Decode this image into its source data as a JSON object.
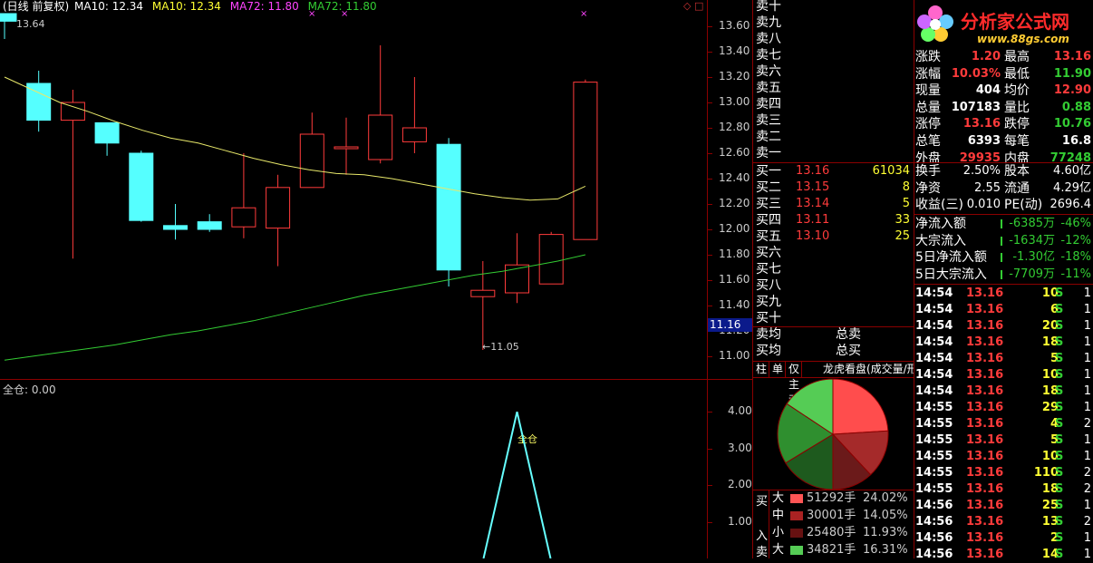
{
  "chart_header": {
    "period": "(日线 前复权)",
    "ma10_a": "MA10: 12.34",
    "ma10_b": "MA10: 12.34",
    "ma72_a": "MA72: 11.80",
    "ma72_b": "MA72: 11.80",
    "high_marker": "13.64",
    "low_marker": "11.05",
    "current_price_box": "11.16"
  },
  "price_axis": [
    "13.60",
    "13.40",
    "13.20",
    "13.00",
    "12.80",
    "12.60",
    "12.40",
    "12.20",
    "12.00",
    "11.80",
    "11.60",
    "11.40",
    "11.20",
    "11.00"
  ],
  "indicator": {
    "title": "全仓: 0.00",
    "peak_label": "全仓",
    "axis": [
      "4.00",
      "3.00",
      "2.00",
      "1.00"
    ]
  },
  "chart_data": {
    "type": "candlestick",
    "ylim": [
      10.95,
      13.7
    ],
    "candles": [
      {
        "o": 13.7,
        "h": 13.64,
        "l": 13.5,
        "c": 13.64,
        "up": false
      },
      {
        "o": 13.15,
        "h": 13.25,
        "l": 12.77,
        "c": 12.86,
        "up": false
      },
      {
        "o": 12.86,
        "h": 13.1,
        "l": 11.77,
        "c": 13.0,
        "up": true
      },
      {
        "o": 12.84,
        "h": 12.84,
        "l": 12.58,
        "c": 12.68,
        "up": false
      },
      {
        "o": 12.6,
        "h": 12.62,
        "l": 12.06,
        "c": 12.07,
        "up": false
      },
      {
        "o": 12.03,
        "h": 12.2,
        "l": 11.92,
        "c": 12.0,
        "up": false
      },
      {
        "o": 12.0,
        "h": 12.12,
        "l": 11.98,
        "c": 12.06,
        "up": false
      },
      {
        "o": 12.02,
        "h": 12.6,
        "l": 11.93,
        "c": 12.17,
        "up": true
      },
      {
        "o": 12.01,
        "h": 12.43,
        "l": 11.71,
        "c": 12.33,
        "up": true
      },
      {
        "o": 12.33,
        "h": 12.92,
        "l": 12.33,
        "c": 12.75,
        "up": true
      },
      {
        "o": 12.65,
        "h": 12.88,
        "l": 12.43,
        "c": 12.65,
        "up": true
      },
      {
        "o": 12.55,
        "h": 13.45,
        "l": 12.52,
        "c": 12.9,
        "up": true
      },
      {
        "o": 12.69,
        "h": 13.2,
        "l": 12.6,
        "c": 12.8,
        "up": true
      },
      {
        "o": 12.67,
        "h": 12.72,
        "l": 11.55,
        "c": 11.68,
        "up": false
      },
      {
        "o": 11.47,
        "h": 11.75,
        "l": 11.05,
        "c": 11.52,
        "up": true
      },
      {
        "o": 11.5,
        "h": 11.97,
        "l": 11.42,
        "c": 11.72,
        "up": true
      },
      {
        "o": 11.57,
        "h": 11.98,
        "l": 11.57,
        "c": 11.96,
        "up": true
      },
      {
        "o": 11.92,
        "h": 13.18,
        "l": 11.92,
        "c": 13.16,
        "up": true
      }
    ],
    "ma10": [
      13.2,
      13.1,
      13.0,
      12.93,
      12.85,
      12.78,
      12.72,
      12.68,
      12.62,
      12.56,
      12.51,
      12.47,
      12.44,
      12.43,
      12.4,
      12.36,
      12.32,
      12.28,
      12.25,
      12.23,
      12.24,
      12.34
    ],
    "ma72": [
      10.97,
      11.0,
      11.03,
      11.06,
      11.09,
      11.13,
      11.17,
      11.2,
      11.24,
      11.28,
      11.33,
      11.38,
      11.43,
      11.48,
      11.52,
      11.56,
      11.6,
      11.64,
      11.67,
      11.71,
      11.75,
      11.8
    ],
    "indicator_values": [
      0,
      0,
      0,
      0,
      0,
      0,
      0,
      0,
      0,
      0,
      0,
      0,
      0,
      0,
      0,
      4,
      0,
      0
    ],
    "indicator_ylim": [
      0,
      4.4
    ]
  },
  "sell_levels": [
    "卖十",
    "卖九",
    "卖八",
    "卖七",
    "卖六",
    "卖五",
    "卖四",
    "卖三",
    "卖二",
    "卖一"
  ],
  "buy_levels": [
    {
      "label": "买一",
      "price": "13.16",
      "vol": "61034"
    },
    {
      "label": "买二",
      "price": "13.15",
      "vol": "8"
    },
    {
      "label": "买三",
      "price": "13.14",
      "vol": "5"
    },
    {
      "label": "买四",
      "price": "13.11",
      "vol": "33"
    },
    {
      "label": "买五",
      "price": "13.10",
      "vol": "25"
    },
    {
      "label": "买六",
      "price": "",
      "vol": ""
    },
    {
      "label": "买七",
      "price": "",
      "vol": ""
    },
    {
      "label": "买八",
      "price": "",
      "vol": ""
    },
    {
      "label": "买九",
      "price": "",
      "vol": ""
    },
    {
      "label": "买十",
      "price": "",
      "vol": ""
    }
  ],
  "avg_rows": [
    {
      "label": "卖均",
      "total": "总卖"
    },
    {
      "label": "买均",
      "total": "总买"
    }
  ],
  "tabs": [
    "柱",
    "单",
    "仅主动",
    "龙虎看盘(成交量/形"
  ],
  "logo": {
    "text": "分析家公式网",
    "url": "www.88gs.com"
  },
  "quote_rows": [
    {
      "l1": "涨跌",
      "v1": "1.20",
      "l2": "最高",
      "v2": "13.16"
    },
    {
      "l1": "涨幅",
      "v1": "10.03%",
      "l2": "最低",
      "v2": "11.90"
    },
    {
      "l1": "现量",
      "v1": "404",
      "l2": "均价",
      "v2": "12.90"
    },
    {
      "l1": "总量",
      "v1": "107183",
      "l2": "量比",
      "v2": "0.88"
    },
    {
      "l1": "涨停",
      "v1": "13.16",
      "l2": "跌停",
      "v2": "10.76"
    },
    {
      "l1": "总笔",
      "v1": "6393",
      "l2": "每笔",
      "v2": "16.8"
    },
    {
      "l1": "外盘",
      "v1": "29935",
      "l2": "内盘",
      "v2": "77248"
    }
  ],
  "info_rows": [
    {
      "l1": "换手",
      "v1": "2.50%",
      "l2": "股本",
      "v2": "4.60亿"
    },
    {
      "l1": "净资",
      "v1": "2.55",
      "l2": "流通",
      "v2": "4.29亿"
    },
    {
      "l1": "收益(三)",
      "v1": "0.010",
      "l2": "PE(动)",
      "v2": "2696.4"
    }
  ],
  "flow_rows": [
    {
      "label": "净流入额",
      "value": "-6385万",
      "pct": "-46%"
    },
    {
      "label": "大宗流入",
      "value": "-1634万",
      "pct": "-12%"
    },
    {
      "label": "5日净流入额",
      "value": "-1.30亿",
      "pct": "-18%"
    },
    {
      "label": "5日大宗流入",
      "value": "-7709万",
      "pct": "-11%"
    }
  ],
  "ticks": [
    {
      "time": "14:54",
      "price": "13.16",
      "vol": "10",
      "side": "S",
      "n": "1"
    },
    {
      "time": "14:54",
      "price": "13.16",
      "vol": "6",
      "side": "S",
      "n": "1"
    },
    {
      "time": "14:54",
      "price": "13.16",
      "vol": "20",
      "side": "S",
      "n": "1"
    },
    {
      "time": "14:54",
      "price": "13.16",
      "vol": "18",
      "side": "S",
      "n": "1"
    },
    {
      "time": "14:54",
      "price": "13.16",
      "vol": "5",
      "side": "S",
      "n": "1"
    },
    {
      "time": "14:54",
      "price": "13.16",
      "vol": "10",
      "side": "S",
      "n": "1"
    },
    {
      "time": "14:54",
      "price": "13.16",
      "vol": "18",
      "side": "S",
      "n": "1"
    },
    {
      "time": "14:55",
      "price": "13.16",
      "vol": "29",
      "side": "S",
      "n": "1"
    },
    {
      "time": "14:55",
      "price": "13.16",
      "vol": "4",
      "side": "S",
      "n": "2"
    },
    {
      "time": "14:55",
      "price": "13.16",
      "vol": "5",
      "side": "S",
      "n": "1"
    },
    {
      "time": "14:55",
      "price": "13.16",
      "vol": "10",
      "side": "S",
      "n": "1"
    },
    {
      "time": "14:55",
      "price": "13.16",
      "vol": "110",
      "side": "S",
      "n": "2"
    },
    {
      "time": "14:55",
      "price": "13.16",
      "vol": "18",
      "side": "S",
      "n": "2"
    },
    {
      "time": "14:56",
      "price": "13.16",
      "vol": "25",
      "side": "S",
      "n": "1"
    },
    {
      "time": "14:56",
      "price": "13.16",
      "vol": "13",
      "side": "S",
      "n": "2"
    },
    {
      "time": "14:56",
      "price": "13.16",
      "vol": "2",
      "side": "S",
      "n": "1"
    },
    {
      "time": "14:56",
      "price": "13.16",
      "vol": "14",
      "side": "S",
      "n": "1"
    }
  ],
  "bs_side_labels": {
    "buy": "买",
    "in": "入",
    "sell": "卖"
  },
  "bs_rows": [
    {
      "size": "大",
      "color": "#ff5555",
      "hands": "51292手",
      "pct": "24.02%"
    },
    {
      "size": "中",
      "color": "#aa2222",
      "hands": "30001手",
      "pct": "14.05%"
    },
    {
      "size": "小",
      "color": "#661111",
      "hands": "25480手",
      "pct": "11.93%"
    },
    {
      "size": "大",
      "color": "#55cc55",
      "hands": "34821手",
      "pct": "16.31%"
    }
  ],
  "pie": {
    "slices": [
      {
        "pct": 24.02,
        "color": "#ff4d4d"
      },
      {
        "pct": 14.05,
        "color": "#a52a2a"
      },
      {
        "pct": 11.93,
        "color": "#6b1a1a"
      },
      {
        "pct": 16.31,
        "color": "#1e5a1e"
      },
      {
        "pct": 18.0,
        "color": "#2f8f2f"
      },
      {
        "pct": 15.69,
        "color": "#55cc55"
      }
    ]
  }
}
